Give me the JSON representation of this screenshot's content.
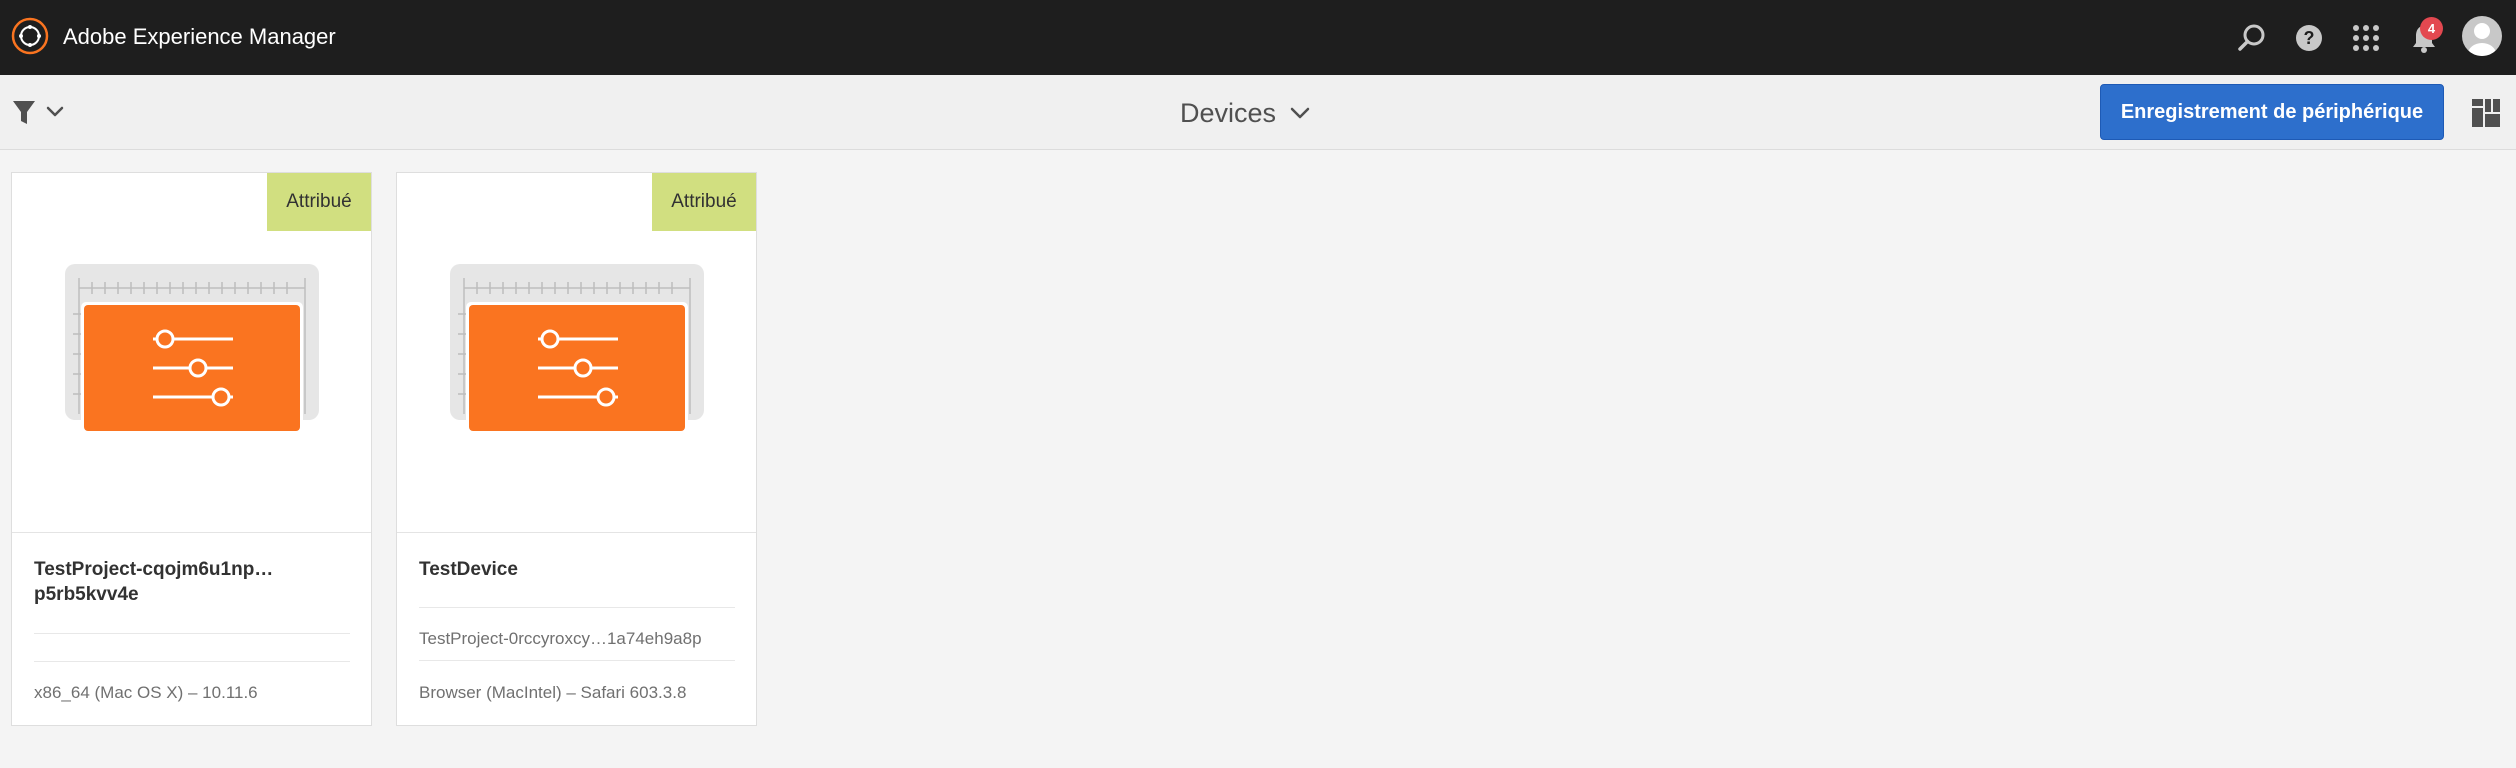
{
  "shell": {
    "app_title": "Adobe Experience Manager",
    "notification_count": "4",
    "icons": [
      "adobe-logo-icon",
      "search-icon",
      "help-icon",
      "apps-grid-icon",
      "bell-icon",
      "avatar-icon"
    ]
  },
  "actionbar": {
    "page_title": "Devices",
    "primary_button_label": "Enregistrement de périphérique",
    "icons": [
      "filter-icon",
      "chevron-down-icon",
      "card-view-icon"
    ]
  },
  "cards": [
    {
      "status": "Attribué",
      "title": "TestProject-cqojm6u1np… p5rb5kvv4e",
      "project": "",
      "platform": "x86_64 (Mac OS X) – 10.11.6"
    },
    {
      "status": "Attribué",
      "title": "TestDevice",
      "project": "TestProject-0rccyroxcy…1a74eh9a8p",
      "platform": "Browser (MacIntel) – Safari 603.3.8"
    }
  ],
  "colors": {
    "shell_bg": "#1e1e1e",
    "accent_orange": "#fa7420",
    "primary_blue": "#2d6fcc",
    "status_tag": "#d1df80",
    "notification_red": "#e34850"
  }
}
